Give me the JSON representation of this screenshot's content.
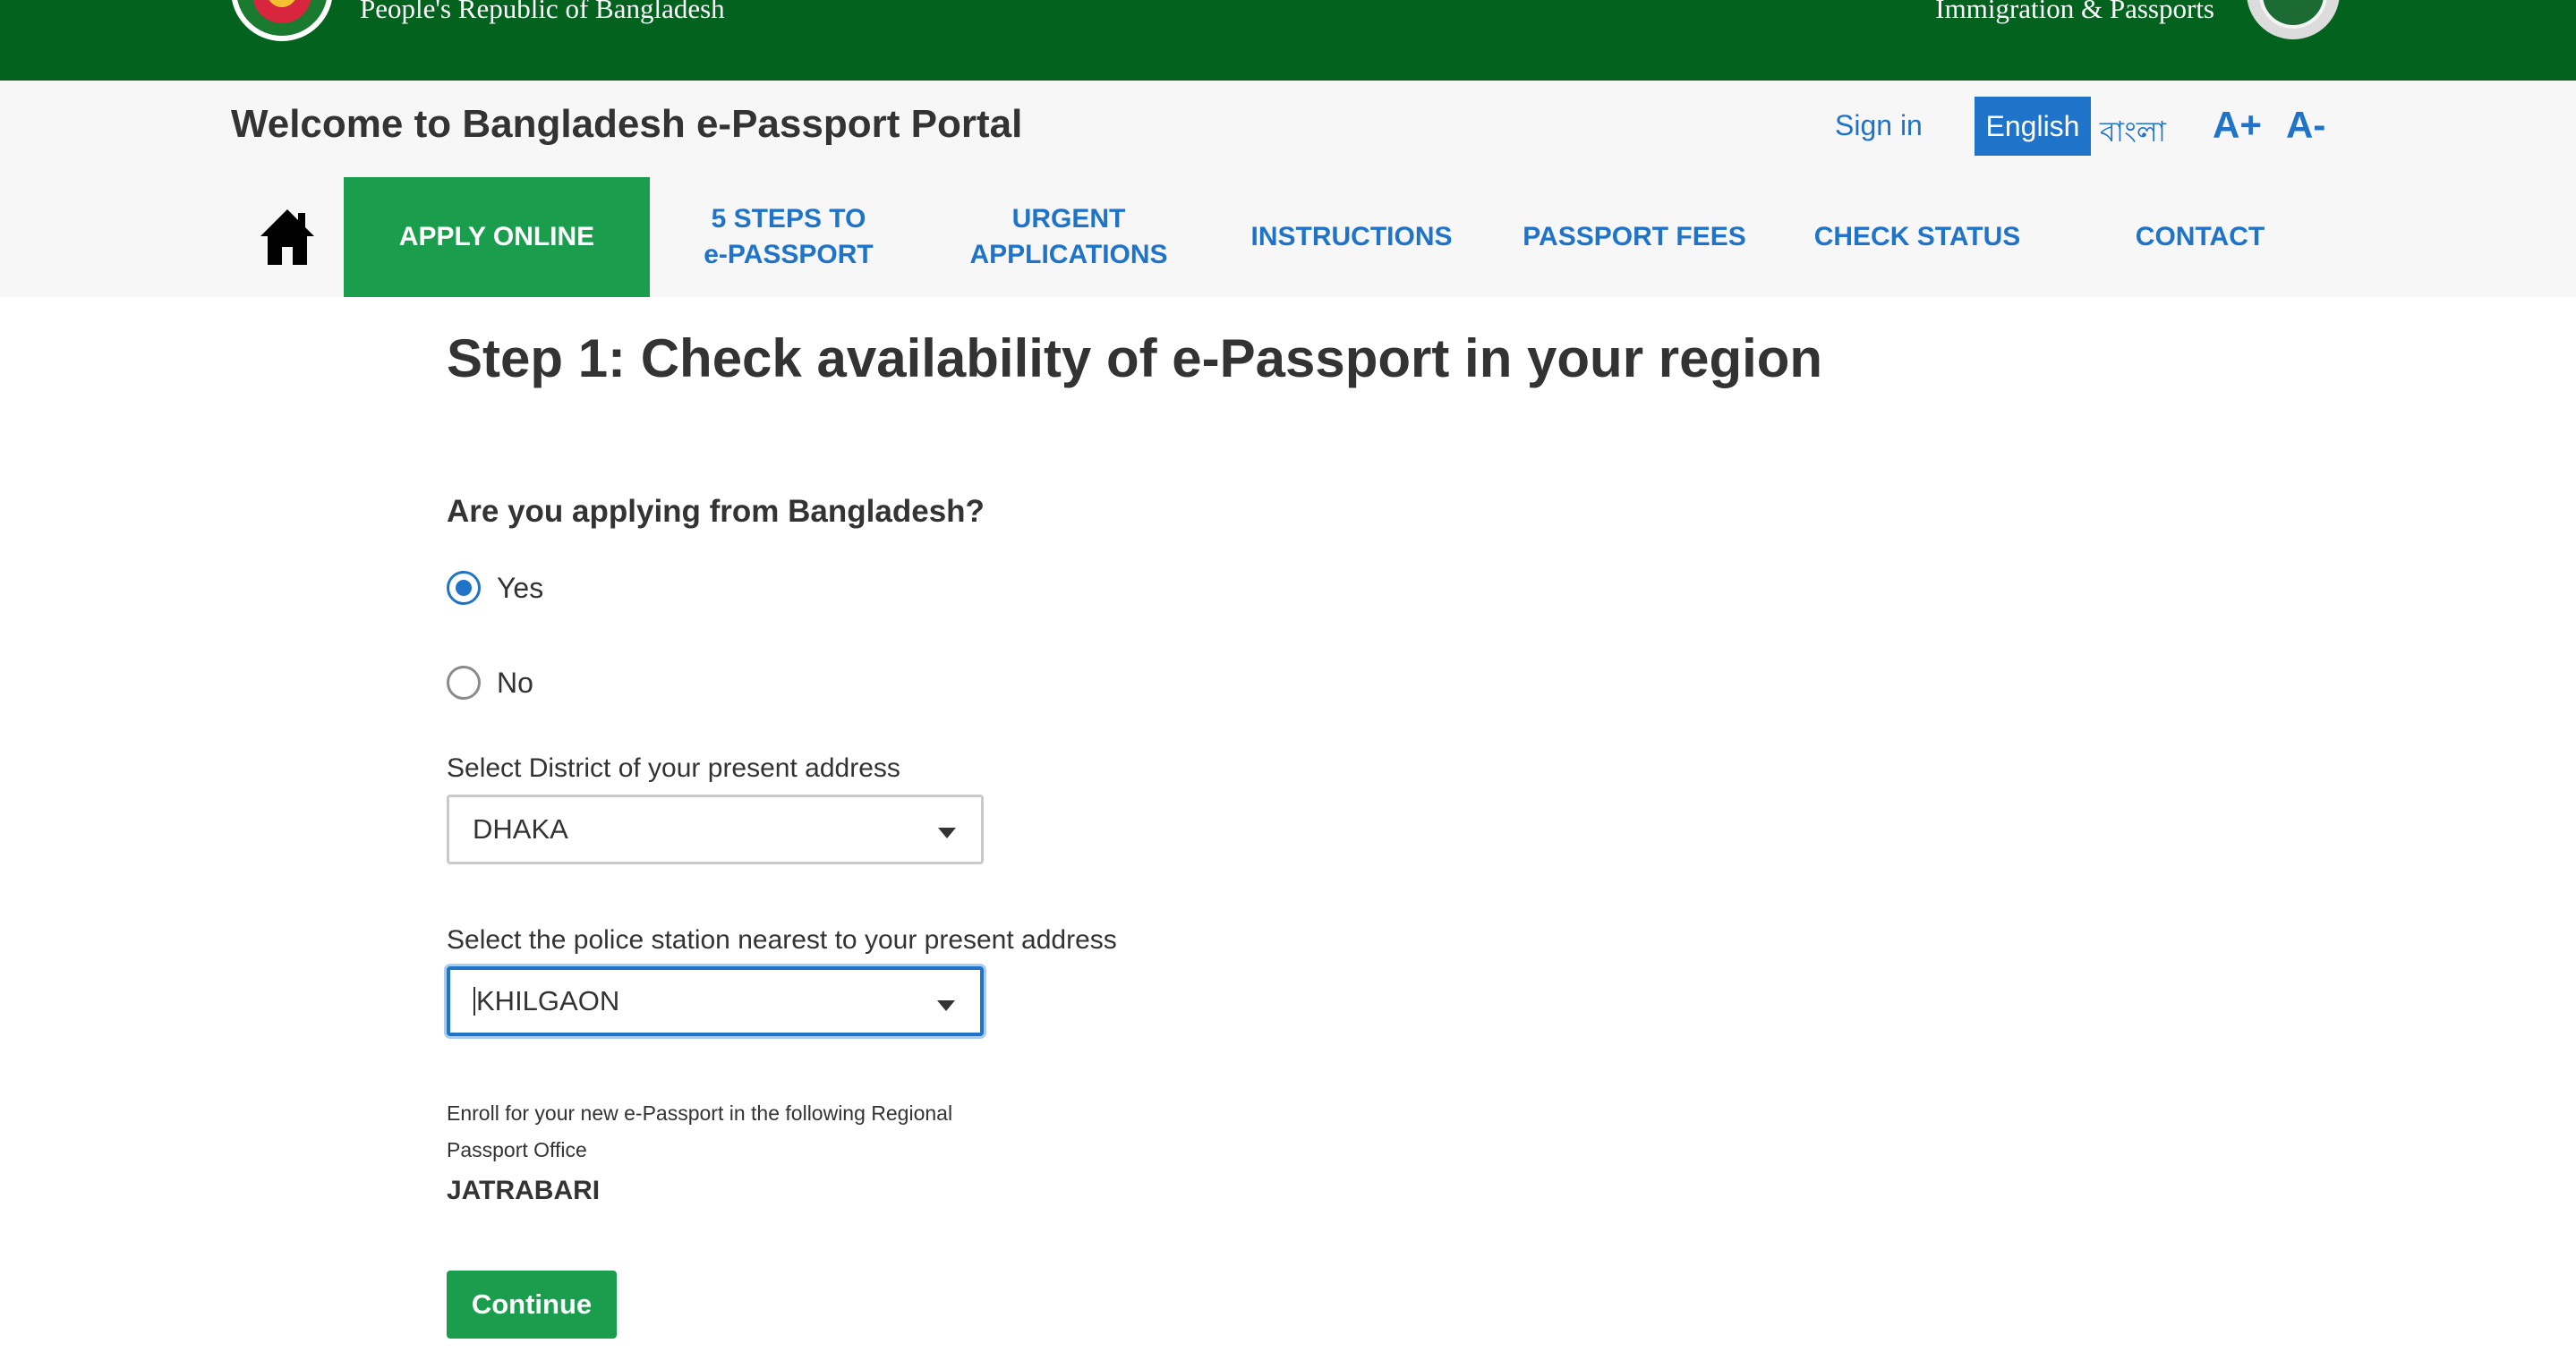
{
  "topbar": {
    "gov_name": "People's Republic of Bangladesh",
    "dept_name": "Immigration & Passports",
    "left_emblem": "bangladesh-government-emblem",
    "right_emblem": "department-emblem"
  },
  "header": {
    "portal_title": "Welcome to Bangladesh e-Passport Portal",
    "sign_in": "Sign in",
    "lang_english": "English",
    "lang_bangla": "বাংলা",
    "font_increase": "A+",
    "font_decrease": "A-"
  },
  "nav": {
    "home_icon": "home-icon",
    "items": [
      {
        "line1": "APPLY ONLINE",
        "line2": ""
      },
      {
        "line1": "5 STEPS TO",
        "line2": "e-PASSPORT"
      },
      {
        "line1": "URGENT",
        "line2": "APPLICATIONS"
      },
      {
        "line1": "INSTRUCTIONS",
        "line2": ""
      },
      {
        "line1": "PASSPORT FEES",
        "line2": ""
      },
      {
        "line1": "CHECK STATUS",
        "line2": ""
      },
      {
        "line1": "CONTACT",
        "line2": ""
      }
    ]
  },
  "main": {
    "step_title": "Step 1: Check availability of e-Passport in your region",
    "question": "Are you applying from Bangladesh?",
    "option_yes": "Yes",
    "option_no": "No",
    "selected_option": "Yes",
    "district_label": "Select District of your present address",
    "district_value": "DHAKA",
    "police_label": "Select the police station nearest to your present address",
    "police_value": "KHILGAON",
    "enroll_note": "Enroll for your new e-Passport in the following Regional Passport Office",
    "office_name": "JATRABARI",
    "continue_label": "Continue"
  },
  "colors": {
    "topbar_green": "#04621f",
    "accent_green": "#1a9e4e",
    "link_blue": "#1f73c8",
    "header_bg": "#f7f7f7"
  }
}
